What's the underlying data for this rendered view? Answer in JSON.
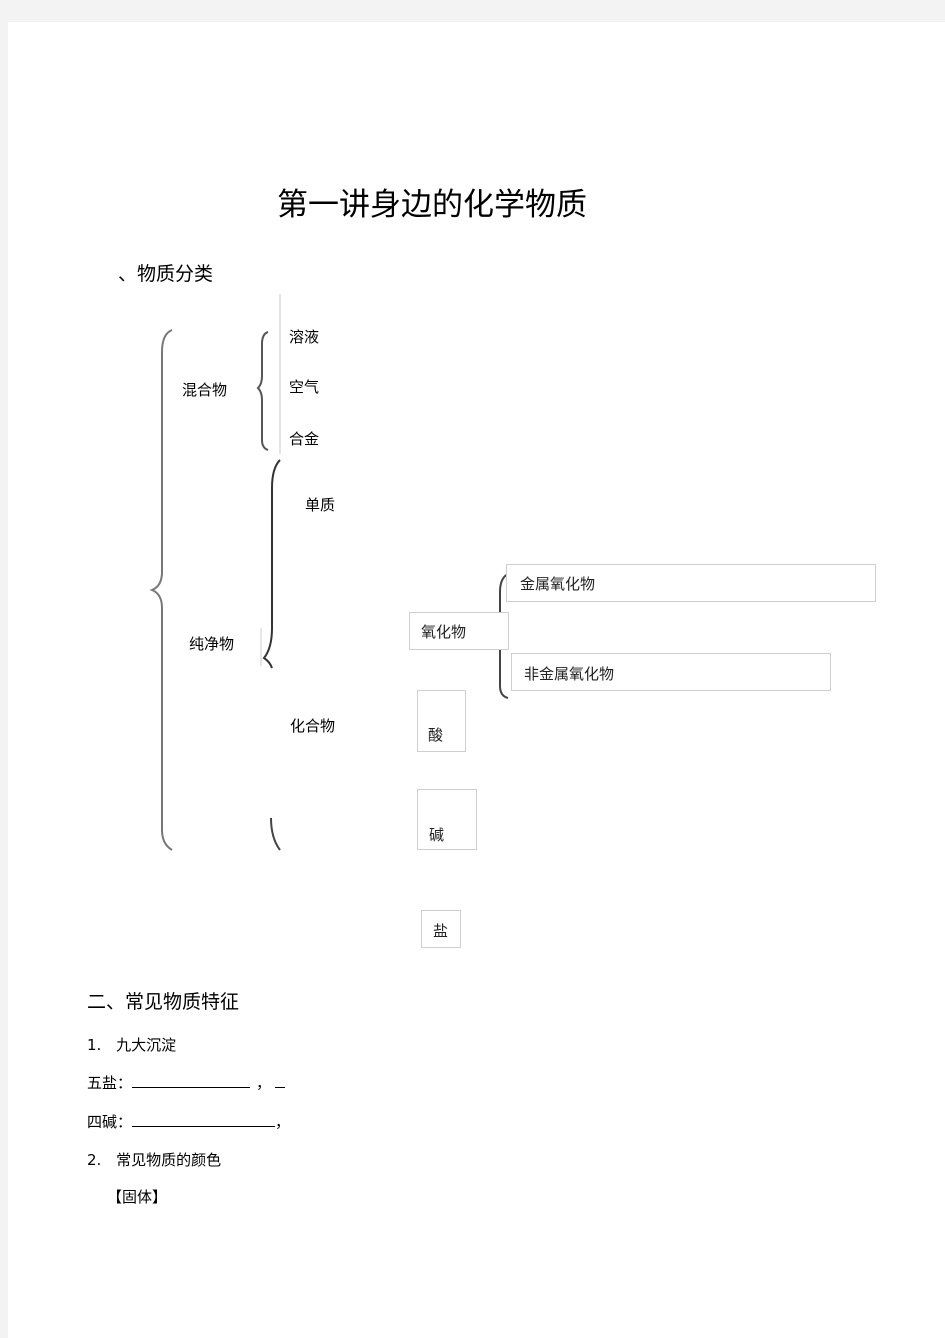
{
  "page_title": "第一讲身边的化学物质",
  "section1": {
    "heading": "、物质分类",
    "tree": {
      "mixture": {
        "label": "混合物",
        "children": [
          "溶液",
          "空气",
          "合金"
        ]
      },
      "pure": {
        "label": "纯净物",
        "element": "单质",
        "compound": {
          "label": "化合物",
          "oxide": {
            "label": "氧化物",
            "children": [
              "金属氧化物",
              "非金属氧化物"
            ]
          },
          "acid": "酸",
          "base": "碱",
          "salt": "盐"
        }
      }
    }
  },
  "section2": {
    "heading": "二、常见物质特征",
    "item1": {
      "number": "1.",
      "text": "九大沉淀"
    },
    "five_salts": {
      "label": "五盐：",
      "after": "，"
    },
    "four_bases": {
      "label": "四碱：",
      "after": "，"
    },
    "item2": {
      "number": "2.",
      "text": "常见物质的颜色"
    },
    "solid": "【固体】"
  }
}
